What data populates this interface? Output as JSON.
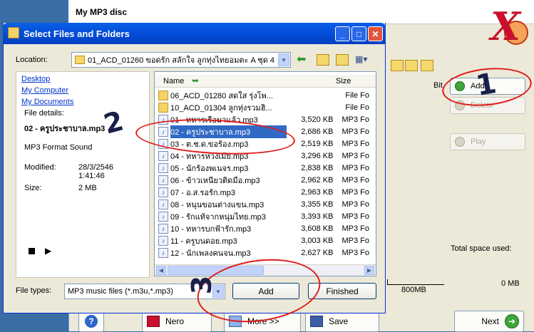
{
  "background_app": {
    "title": "My MP3 disc",
    "add_label": "Add",
    "delete_label": "Delete",
    "play_label": "Play",
    "bit_label": "Bit",
    "total_space_label": "Total space used:",
    "total_space_value": "0 MB",
    "scale_label": "800MB",
    "help_label": "?",
    "nero_label": "Nero",
    "more_label": "More >>",
    "save_label": "Save",
    "next_label": "Next"
  },
  "dialog": {
    "title": "Select Files and Folders",
    "location_label": "Location:",
    "location_value": "01_ACD_01260 ขอดรัก สลักใจ ลูกทุ่งไทยอมตะ A ชุด 4",
    "left_links": [
      "Desktop",
      "My Computer",
      "My Documents"
    ],
    "file_details_label": "File details:",
    "selected_file": "02 - ครูประชาบาล.mp3",
    "format": "MP3 Format Sound",
    "modified_label": "Modified:",
    "modified_date": "28/3/2546",
    "modified_time": "1:41:46",
    "size_label": "Size:",
    "size_value": "2 MB",
    "columns": {
      "name": "Name",
      "size": "Size"
    },
    "files": [
      {
        "name": "06_ACD_01280 สดใส รุ่งโพ...",
        "size": "",
        "type": "File Fo",
        "kind": "folder"
      },
      {
        "name": "10_ACD_01304 ลูกทุ่งรวมฮิ...",
        "size": "",
        "type": "File Fo",
        "kind": "folder"
      },
      {
        "name": "01 - ทหารเรือมาแล้ว.mp3",
        "size": "3,520 KB",
        "type": "MP3 Fo",
        "kind": "mp3"
      },
      {
        "name": "02 - ครูประชาบาล.mp3",
        "size": "2,686 KB",
        "type": "MP3 Fo",
        "kind": "mp3",
        "selected": true
      },
      {
        "name": "03 - ต.ช.ด.ขอร้อง.mp3",
        "size": "2,519 KB",
        "type": "MP3 Fo",
        "kind": "mp3"
      },
      {
        "name": "04 - ทหารห่วงเมีย.mp3",
        "size": "3,296 KB",
        "type": "MP3 Fo",
        "kind": "mp3"
      },
      {
        "name": "05 - นักร้องพเนจร.mp3",
        "size": "2,838 KB",
        "type": "MP3 Fo",
        "kind": "mp3"
      },
      {
        "name": "06 - ข้าวเหนียวติดมือ.mp3",
        "size": "2,962 KB",
        "type": "MP3 Fo",
        "kind": "mp3"
      },
      {
        "name": "07 - อ.ส.รอรัก.mp3",
        "size": "2,963 KB",
        "type": "MP3 Fo",
        "kind": "mp3"
      },
      {
        "name": "08 - หนุนขอนต่างแขน.mp3",
        "size": "3,355 KB",
        "type": "MP3 Fo",
        "kind": "mp3"
      },
      {
        "name": "09 - รักแท้จากหนุ่มไทย.mp3",
        "size": "3,393 KB",
        "type": "MP3 Fo",
        "kind": "mp3"
      },
      {
        "name": "10 - ทหารบกฟ้ารัก.mp3",
        "size": "3,608 KB",
        "type": "MP3 Fo",
        "kind": "mp3"
      },
      {
        "name": "11 - ครูบนดอย.mp3",
        "size": "3,003 KB",
        "type": "MP3 Fo",
        "kind": "mp3"
      },
      {
        "name": "12 - นักเพลงคนจน.mp3",
        "size": "2,627 KB",
        "type": "MP3 Fo",
        "kind": "mp3"
      }
    ],
    "file_types_label": "File types:",
    "file_types_value": "MP3 music files (*.m3u,*.mp3)",
    "add_label": "Add",
    "finished_label": "Finished"
  },
  "annotations": [
    "1",
    "2",
    "3"
  ],
  "colors": {
    "annotation_red": "#e01b1b",
    "titlebar_blue": "#0149d4",
    "selection_blue": "#316ac5"
  }
}
